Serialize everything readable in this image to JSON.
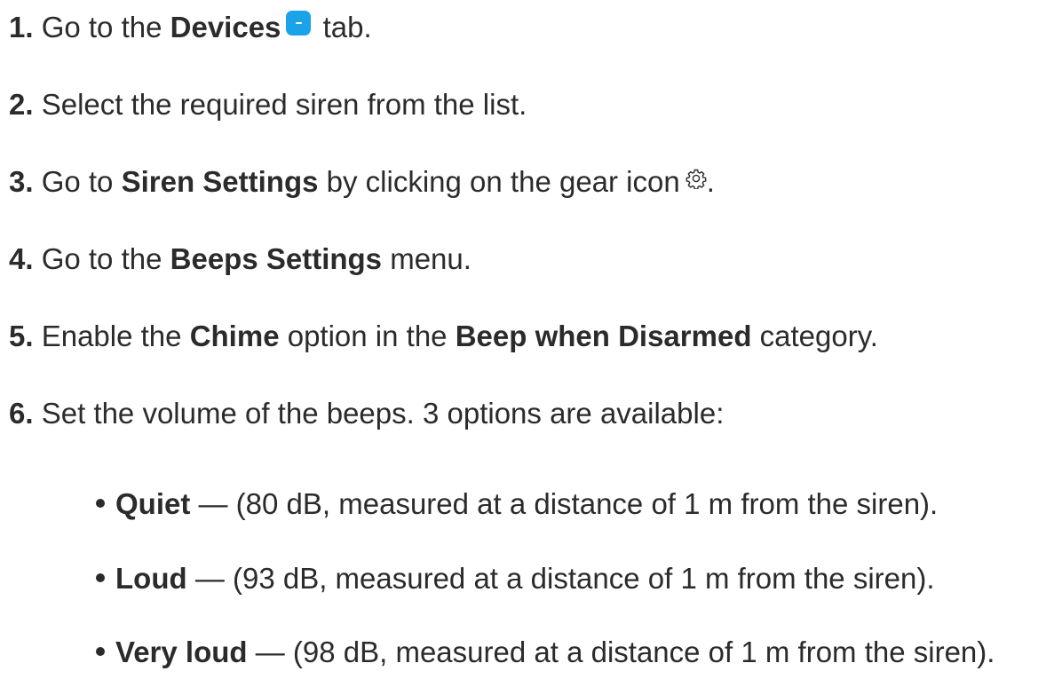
{
  "steps": [
    {
      "num": "1.",
      "pre": "Go to the",
      "bold": "Devices",
      "post": "tab.",
      "icon": "devices-icon"
    },
    {
      "num": "2.",
      "text": "Select the required siren from the list."
    },
    {
      "num": "3.",
      "pre": "Go to",
      "bold": "Siren Settings",
      "post": "by clicking on the gear icon",
      "end": ".",
      "icon": "gear-icon"
    },
    {
      "num": "4.",
      "pre": "Go to the",
      "bold": "Beeps Settings",
      "post": "menu."
    },
    {
      "num": "5.",
      "pre": "Enable the",
      "bold": "Chime",
      "mid": "option in the",
      "bold2": "Beep when Disarmed",
      "post": "category."
    },
    {
      "num": "6.",
      "text": "Set the volume of the beeps. 3 options are available:"
    }
  ],
  "volume_options": [
    {
      "label": "Quiet",
      "desc": "— (80 dB, measured at a distance of 1 m from the siren)."
    },
    {
      "label": "Loud",
      "desc": "— (93 dB, measured at a distance of 1 m from the siren)."
    },
    {
      "label": "Very loud",
      "desc": "— (98 dB, measured at a distance of 1 m from the siren)."
    }
  ],
  "colors": {
    "text": "#2b2b2b",
    "devices_icon": "#1aa3e8"
  }
}
